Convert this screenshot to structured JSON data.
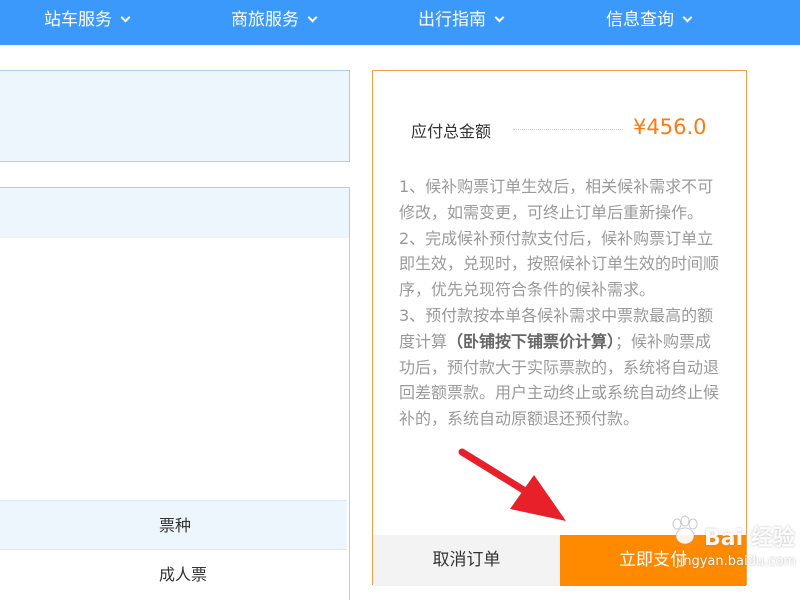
{
  "nav": {
    "items": [
      {
        "label": "站车服务"
      },
      {
        "label": "商旅服务"
      },
      {
        "label": "出行指南"
      },
      {
        "label": "信息查询"
      }
    ]
  },
  "table": {
    "header": "票种",
    "row_value": "成人票"
  },
  "payment": {
    "total_label": "应付总金额",
    "total_amount": "¥456.0",
    "note1": "1、候补购票订单生效后，相关候补需求不可修改，如需变更，可终止订单后重新操作。",
    "note2": "2、完成候补预付款支付后，候补购票订单立即生效，兑现时，按照候补订单生效的时间顺序，优先兑现符合条件的候补需求。",
    "note3_pre": "3、预付款按本单各候补需求中票款最高的额度计算",
    "note3_bold": "（卧铺按下铺票价计算）",
    "note3_post": "；候补购票成功后，预付款大于实际票款的，系统将自动退回差额票款。用户主动终止或系统自动终止候补的，系统自动原额退还预付款。",
    "cancel_label": "取消订单",
    "pay_label": "立即支付"
  },
  "watermark": {
    "text": "Bai 经验",
    "url": "jingyan.baidu.com"
  },
  "colors": {
    "nav_bg": "#3b99fc",
    "accent_orange": "#ff8a00",
    "amount_orange": "#ff7a14",
    "panel_border": "#f0a24a",
    "arrow_red": "#e8202a"
  }
}
